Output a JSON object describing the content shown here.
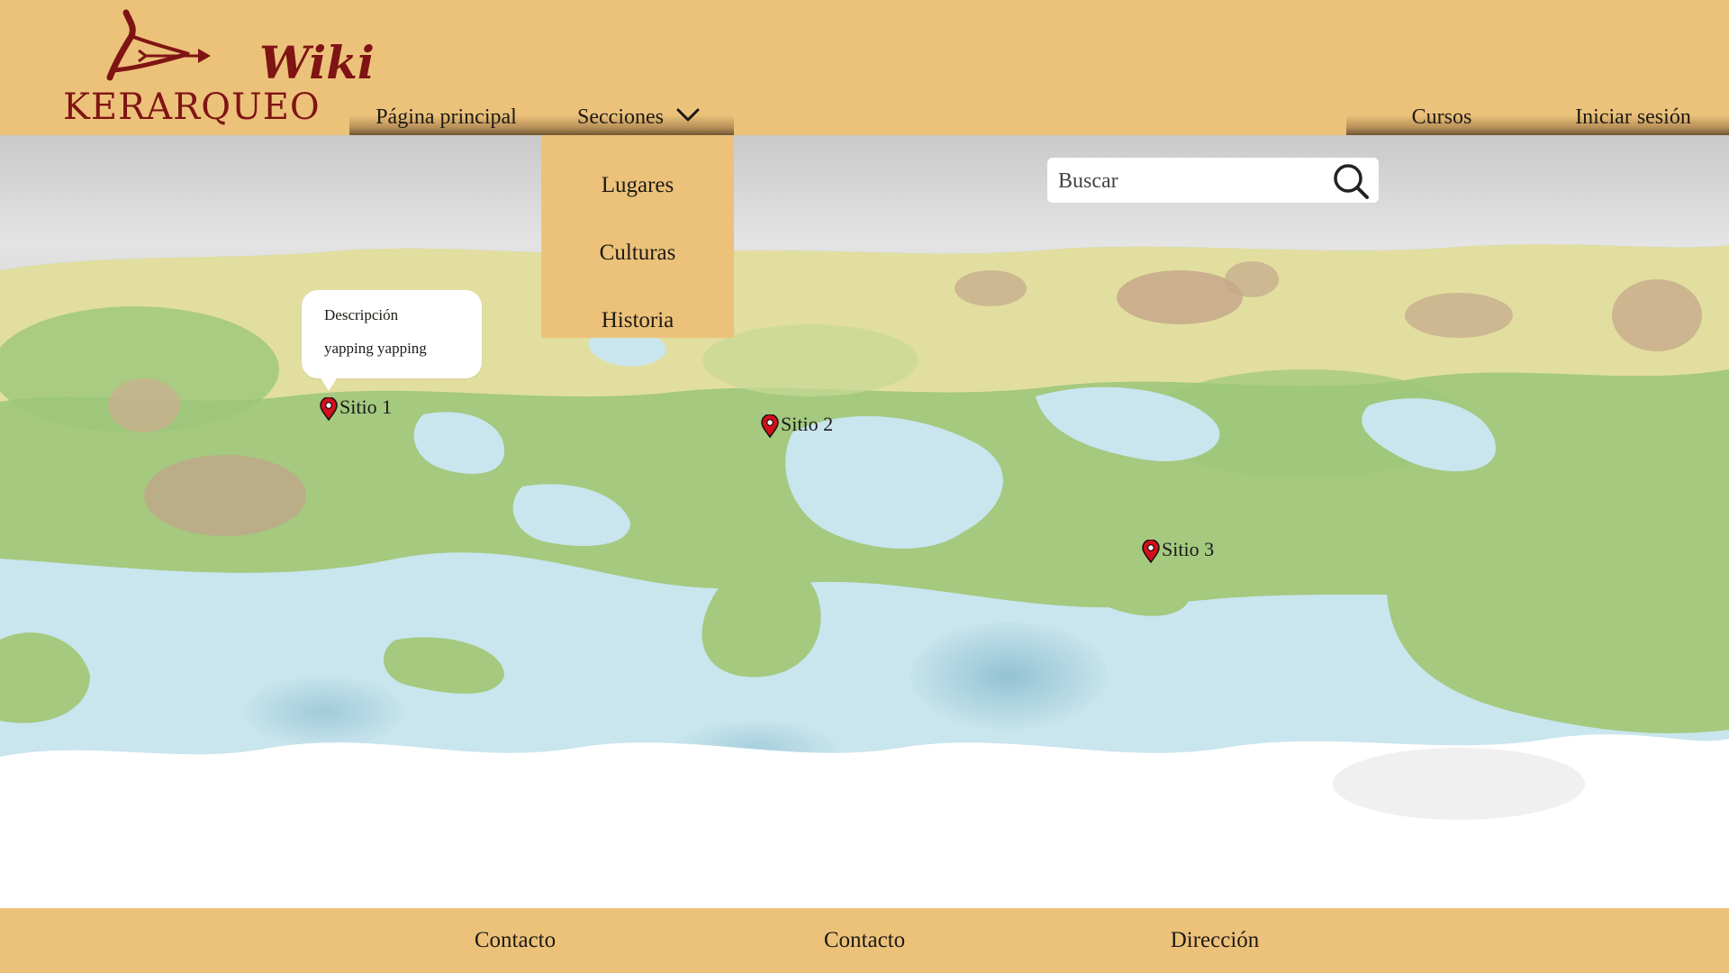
{
  "header": {
    "logo_text": "KERARQUEO",
    "wiki_label": "Wiki",
    "nav": {
      "home": "Página principal",
      "sections": "Secciones",
      "courses": "Cursos",
      "login": "Iniciar sesión"
    }
  },
  "dropdown": {
    "items": [
      "Lugares",
      "Culturas",
      "Historia"
    ]
  },
  "search": {
    "placeholder": "Buscar",
    "icon": "search-icon"
  },
  "map": {
    "markers": [
      {
        "label": "Sitio 1",
        "icon": "map-pin-icon"
      },
      {
        "label": "Sitio 2",
        "icon": "map-pin-icon"
      },
      {
        "label": "Sitio 3",
        "icon": "map-pin-icon"
      }
    ],
    "tooltip": {
      "title": "Descripción",
      "body": "yapping yapping"
    }
  },
  "footer": {
    "items": [
      "Contacto",
      "Contacto",
      "Dirección"
    ]
  },
  "colors": {
    "bar": "#ecc27a",
    "logo": "#7f1414",
    "pin": "#d40f1a",
    "land": "#9cc77a",
    "water": "#c9e5ee"
  }
}
